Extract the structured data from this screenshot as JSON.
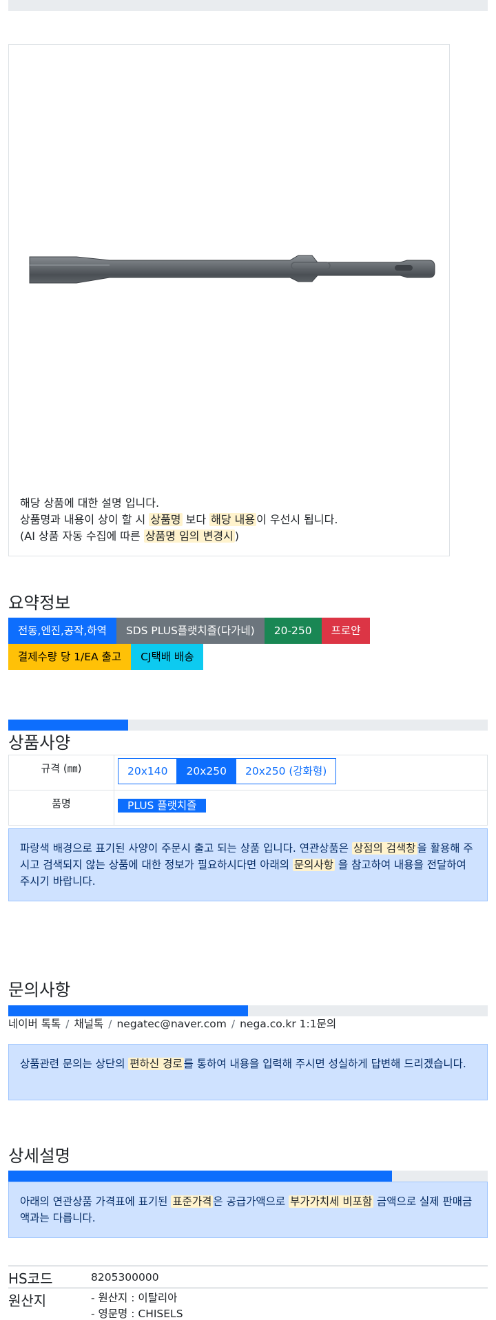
{
  "product": {
    "image_alt": "SDS PLUS 플랫치즐",
    "description": {
      "line1": "해당 상품에 대한 설명 입니다.",
      "line2_a": "상품명과 내용이 상이 할 시 ",
      "line2_m1": "상품명",
      "line2_b": " 보다 ",
      "line2_m2": "해당 내용",
      "line2_c": "이 우선시 됩니다.",
      "line3_a": "(AI 상품 자동 수집에 따른 ",
      "line3_m": "상품명 임의 변경시",
      "line3_b": ")"
    }
  },
  "summary": {
    "title": "요약정보",
    "badges": [
      {
        "label": "전동,엔진,공작,하역",
        "color": "#0d6efd"
      },
      {
        "label": "SDS PLUS플랫치즐(다가네)",
        "color": "#6c757d"
      },
      {
        "label": "20-250",
        "color": "#198754"
      },
      {
        "label": "프로얀",
        "color": "#dc3545"
      },
      {
        "label": "결제수량 당 1/EA 출고",
        "color": "#ffc107"
      },
      {
        "label": "CJ택배 배송",
        "color": "#0dcaf0"
      }
    ]
  },
  "spec": {
    "title": "상품사양",
    "progress_percent": 25,
    "rows": [
      {
        "label": "규격 (㎜)",
        "options": [
          "20x140",
          "20x250",
          "20x250 (강화형)"
        ],
        "selected": "20x250"
      },
      {
        "label": "품명",
        "options": [
          "PLUS 플랫치즐"
        ],
        "selected": "PLUS 플랫치즐"
      }
    ],
    "notice": {
      "a": "파랑색 배경으로 표기된 사양이 주문시 출고 되는 상품 입니다. 연관상품은 ",
      "m1": "상점의 검색창",
      "b": "을 활용해 주시고 검색되지 않는 상품에 대한 정보가 필요하시다면 아래의 ",
      "m2": "문의사항",
      "c": " 을 참고하여 내용을 전달하여 주시기 바랍니다."
    }
  },
  "inquiry": {
    "title": "문의사항",
    "progress_percent": 50,
    "channels": [
      "네이버 톡톡",
      "채널톡",
      "negatec@naver.com",
      "nega.co.kr 1:1문의"
    ],
    "separator": "/",
    "notice": {
      "a": "상품관련 문의는 상단의 ",
      "m": "편하신 경로",
      "b": "를 통하여 내용을 입력해 주시면 성실하게 답변해 드리겠습니다."
    }
  },
  "detail": {
    "title": "상세설명",
    "progress_percent": 80,
    "notice": {
      "a": "아래의 연관상품 가격표에 표기된 ",
      "m1": "표준가격",
      "b": "은 공급가액으로 ",
      "m2": "부가가치세 비포함",
      "c": " 금액으로 실제 판매금액과는 다릅니다."
    },
    "hs_code_label": "HS코드",
    "hs_code": "8205300000",
    "origin_label": "원산지",
    "origin_line1": "- 원산지 : 이탈리아",
    "origin_line2": "- 영문명 : CHISELS"
  }
}
